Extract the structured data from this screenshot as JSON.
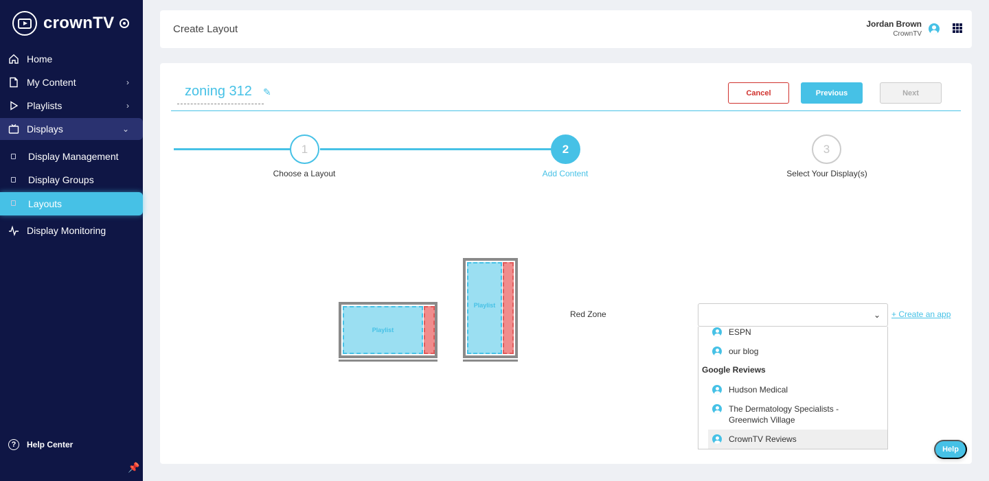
{
  "brand": {
    "name": "crownTV"
  },
  "sidebar": {
    "items": [
      {
        "label": "Home",
        "icon": "home-icon"
      },
      {
        "label": "My Content",
        "icon": "document-icon"
      },
      {
        "label": "Playlists",
        "icon": "play-icon"
      },
      {
        "label": "Displays",
        "icon": "tv-icon"
      },
      {
        "label": "Display Monitoring",
        "icon": "pulse-icon"
      }
    ],
    "subitems": [
      {
        "label": "Display Management"
      },
      {
        "label": "Display Groups"
      },
      {
        "label": "Layouts"
      }
    ],
    "help_center": "Help Center"
  },
  "header": {
    "title": "Create Layout",
    "user_name": "Jordan Brown",
    "user_org": "CrownTV"
  },
  "layout": {
    "name": "zoning 312",
    "buttons": {
      "cancel": "Cancel",
      "previous": "Previous",
      "next": "Next"
    }
  },
  "stepper": {
    "current": 2,
    "steps": [
      {
        "number": "1",
        "label": "Choose a Layout"
      },
      {
        "number": "2",
        "label": "Add Content"
      },
      {
        "number": "3",
        "label": "Select Your Display(s)"
      }
    ]
  },
  "previews": {
    "playlist_label": "Playlist",
    "colors": {
      "playlist": "#9bdff2",
      "red": "#f08c8c"
    }
  },
  "zone_form": {
    "label": "Red Zone",
    "select_value": "",
    "create_app": "+ Create an app",
    "options": [
      {
        "label": "ESPN"
      },
      {
        "label": "our blog"
      }
    ],
    "group_name": "Google Reviews",
    "group_options": [
      {
        "label": "Hudson Medical"
      },
      {
        "label": "The Dermatology Specialists - Greenwich Village"
      },
      {
        "label": "CrownTV Reviews"
      }
    ]
  },
  "help_button": "Help",
  "colors": {
    "accent": "#46c1e6",
    "sidebar": "#0f1645",
    "danger": "#d0312d"
  }
}
